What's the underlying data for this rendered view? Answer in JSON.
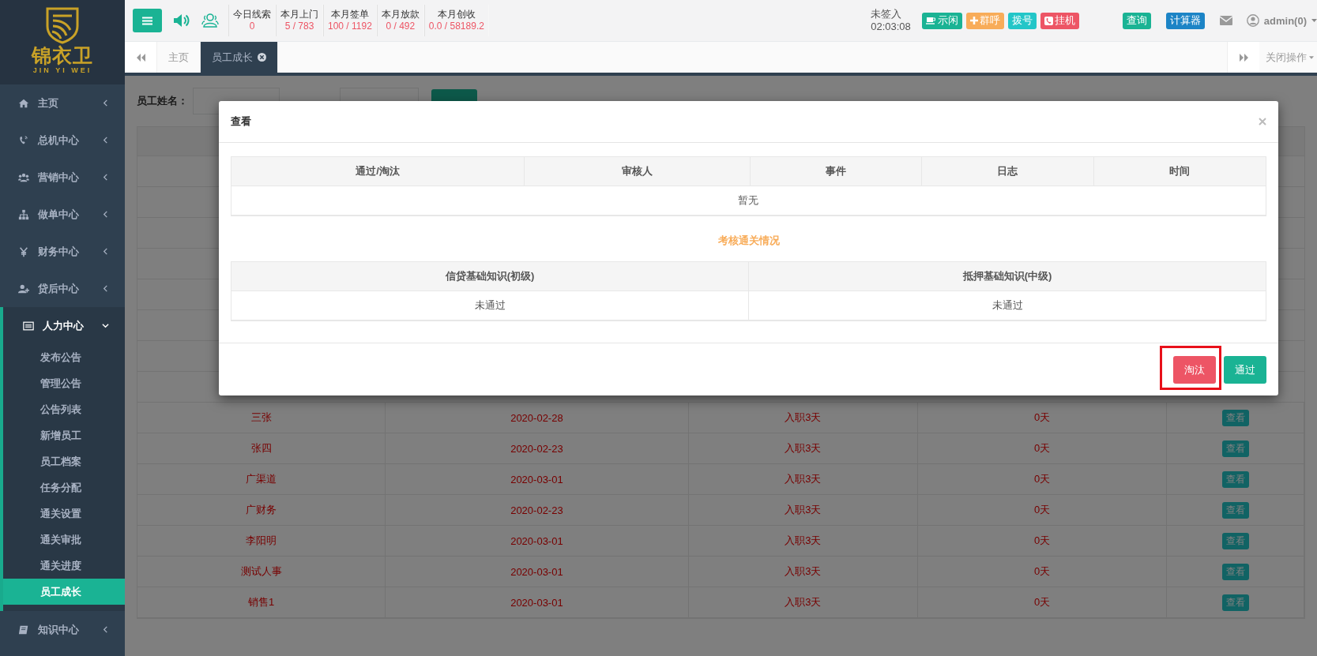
{
  "sidebar": {
    "logo_title": "锦衣卫",
    "logo_subtitle": "JIN YI WEI",
    "items": [
      {
        "label": "主页",
        "expanded": false
      },
      {
        "label": "总机中心",
        "expanded": false
      },
      {
        "label": "营销中心",
        "expanded": false
      },
      {
        "label": "做单中心",
        "expanded": false
      },
      {
        "label": "财务中心",
        "expanded": false
      },
      {
        "label": "贷后中心",
        "expanded": false
      },
      {
        "label": "人力中心",
        "expanded": true,
        "children": [
          {
            "label": "发布公告",
            "selected": false
          },
          {
            "label": "管理公告",
            "selected": false
          },
          {
            "label": "公告列表",
            "selected": false
          },
          {
            "label": "新增员工",
            "selected": false
          },
          {
            "label": "员工档案",
            "selected": false
          },
          {
            "label": "任务分配",
            "selected": false
          },
          {
            "label": "通关设置",
            "selected": false
          },
          {
            "label": "通关审批",
            "selected": false
          },
          {
            "label": "通关进度",
            "selected": false
          },
          {
            "label": "员工成长",
            "selected": true
          }
        ]
      },
      {
        "label": "知识中心",
        "expanded": false
      }
    ]
  },
  "topbar": {
    "stats": [
      {
        "label": "今日线索",
        "value": "0"
      },
      {
        "label": "本月上门",
        "value": "5 / 783"
      },
      {
        "label": "本月签单",
        "value": "100 / 1192"
      },
      {
        "label": "本月放款",
        "value": "0 / 492"
      },
      {
        "label": "本月创收",
        "value": "0.0 / 58189.2"
      }
    ],
    "sign_status": "未签入",
    "timer": "02:03:08",
    "call_buttons": [
      {
        "label": "示闲",
        "kind": "idle"
      },
      {
        "label": "群呼",
        "kind": "group"
      },
      {
        "label": "拨号",
        "kind": "dial"
      },
      {
        "label": "挂机",
        "kind": "hangup"
      }
    ],
    "query_button": "查询",
    "calculator_button": "计算器",
    "user": "admin(0)"
  },
  "tabs": {
    "items": [
      {
        "label": "主页",
        "selected": false,
        "closable": false
      },
      {
        "label": "员工成长",
        "selected": true,
        "closable": true
      }
    ],
    "close_menu": "关闭操作"
  },
  "filter": {
    "name_label": "员工姓名："
  },
  "table": {
    "rows": [
      {
        "cells": [
          "三张",
          "2020-02-28",
          "入职3天",
          "0天"
        ],
        "action": "查看"
      },
      {
        "cells": [
          "张四",
          "2020-02-23",
          "入职3天",
          "0天"
        ],
        "action": "查看"
      },
      {
        "cells": [
          "广渠道",
          "2020-03-01",
          "入职3天",
          "0天"
        ],
        "action": "查看"
      },
      {
        "cells": [
          "广财务",
          "2020-02-23",
          "入职3天",
          "0天"
        ],
        "action": "查看"
      },
      {
        "cells": [
          "李阳明",
          "2020-03-01",
          "入职3天",
          "0天"
        ],
        "action": "查看"
      },
      {
        "cells": [
          "测试人事",
          "2020-03-01",
          "入职3天",
          "0天"
        ],
        "action": "查看"
      },
      {
        "cells": [
          "销售1",
          "2020-03-01",
          "入职3天",
          "0天"
        ],
        "action": "查看"
      }
    ]
  },
  "modal": {
    "title": "查看",
    "review_table": {
      "columns": [
        "通过/淘汰",
        "审核人",
        "事件",
        "日志",
        "时间"
      ],
      "empty_text": "暂无"
    },
    "section_title": "考核通关情况",
    "exam_table": {
      "columns": [
        "信贷基础知识(初级)",
        "抵押基础知识(中级)"
      ],
      "rows": [
        [
          "未通过",
          "未通过"
        ]
      ]
    },
    "buttons": [
      {
        "label": "淘汰",
        "kind": "danger",
        "highlighted": true
      },
      {
        "label": "通过",
        "kind": "success",
        "highlighted": false
      }
    ]
  }
}
